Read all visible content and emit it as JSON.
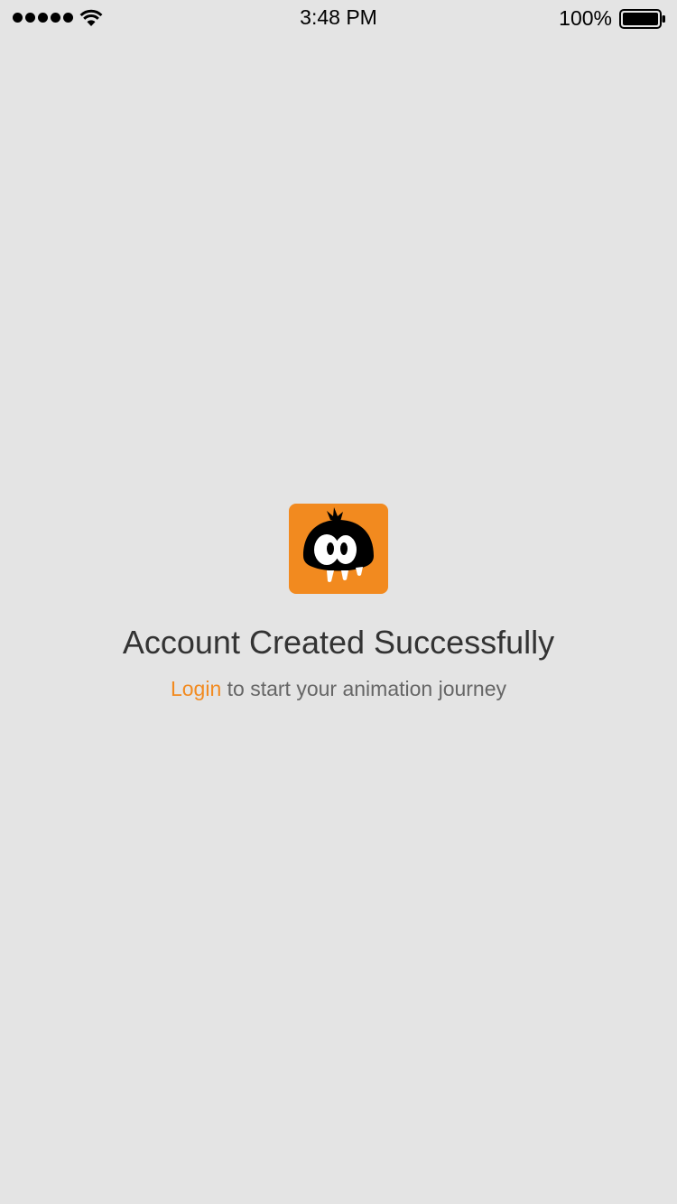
{
  "status_bar": {
    "time": "3:48 PM",
    "battery_percent": "100%",
    "signal_bars": 5,
    "signal_icon": "signal-dots-icon",
    "wifi_icon": "wifi-icon",
    "battery_icon": "battery-icon"
  },
  "main": {
    "logo_icon": "orange-monster-logo-icon",
    "title": "Account Created Successfully",
    "subtitle": {
      "link_label": "Login",
      "rest": " to start your animation journey"
    }
  },
  "colors": {
    "background": "#e4e4e4",
    "accent": "#f28a1f",
    "title_text": "#333333",
    "subtitle_text": "#666666"
  }
}
